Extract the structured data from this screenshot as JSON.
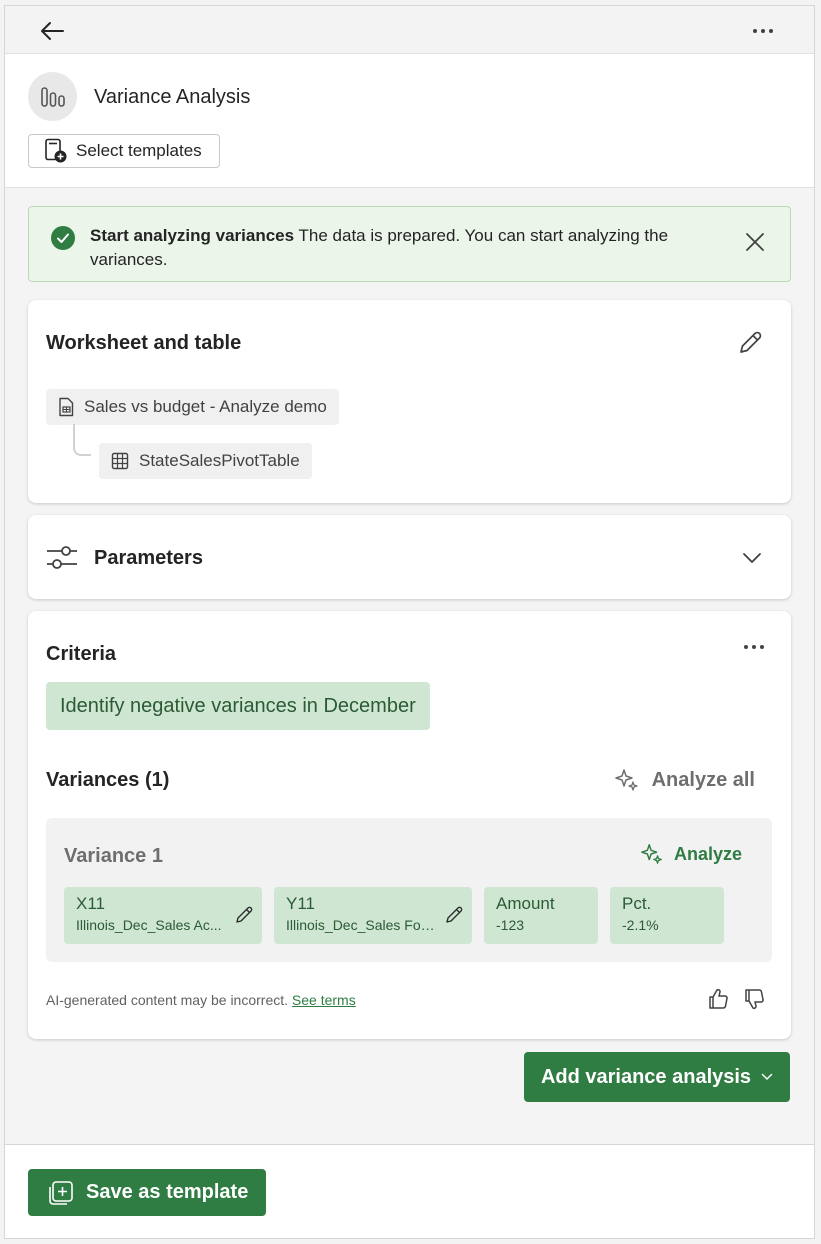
{
  "header": {
    "title": "Variance Analysis",
    "select_templates_label": "Select templates"
  },
  "banner": {
    "title": "Start analyzing variances",
    "message": "The data is prepared. You can start analyzing the variances."
  },
  "worksheet": {
    "title": "Worksheet and table",
    "workbook_name": "Sales vs budget - Analyze demo",
    "table_name": "StateSalesPivotTable"
  },
  "parameters": {
    "title": "Parameters"
  },
  "criteria": {
    "title": "Criteria",
    "text": "Identify negative variances in December",
    "variances_title": "Variances (1)",
    "analyze_all_label": "Analyze all",
    "variance": {
      "title": "Variance 1",
      "analyze_label": "Analyze",
      "cells": [
        {
          "label": "X11",
          "value": "Illinois_Dec_Sales Ac..."
        },
        {
          "label": "Y11",
          "value": "Illinois_Dec_Sales For..."
        },
        {
          "label": "Amount",
          "value": "-123"
        },
        {
          "label": "Pct.",
          "value": "-2.1%"
        }
      ]
    },
    "disclaimer": "AI-generated content may be incorrect.",
    "terms_link": "See terms"
  },
  "actions": {
    "add_variance_label": "Add variance analysis",
    "save_template_label": "Save as template"
  },
  "colors": {
    "accent_green": "#2f7d43",
    "chip_green": "#cfe7d2",
    "banner_bg": "#ebf5ea"
  },
  "icons": [
    "back-arrow-icon",
    "more-icon",
    "chart-bars-icon",
    "template-add-icon",
    "check-circle-icon",
    "close-icon",
    "edit-icon",
    "document-icon",
    "table-grid-icon",
    "sliders-icon",
    "chevron-down-icon",
    "sparkle-icon",
    "thumbs-up-icon",
    "thumbs-down-icon",
    "add-square-icon"
  ]
}
